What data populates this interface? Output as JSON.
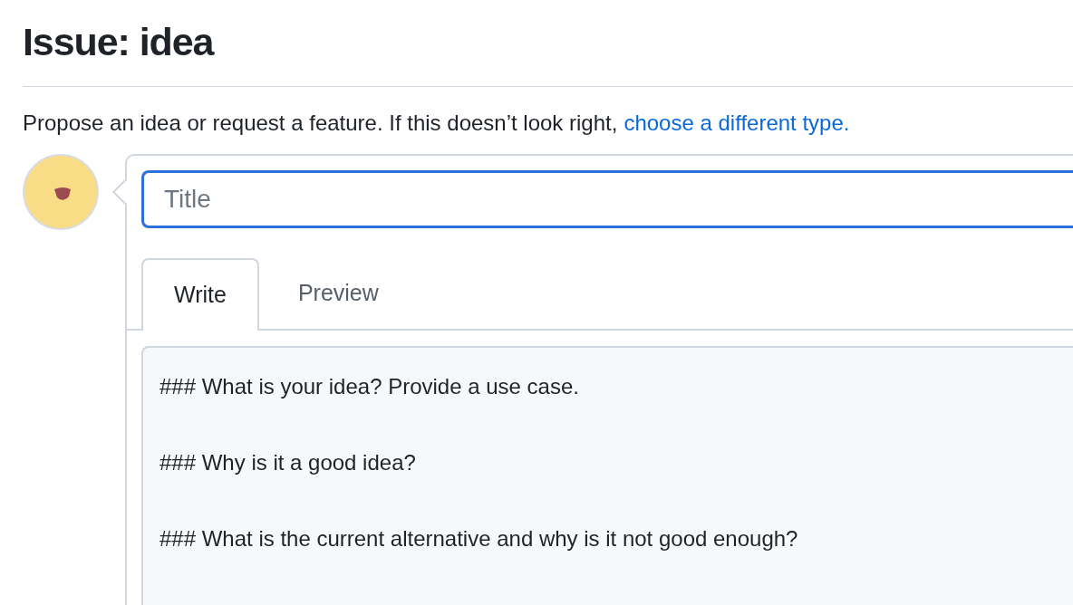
{
  "heading": "Issue: idea",
  "description": {
    "text": "Propose an idea or request a feature. If this doesn’t look right,",
    "link": "choose a different type."
  },
  "title_field": {
    "placeholder": "Title",
    "focused": true
  },
  "tabs": [
    {
      "label": "Write",
      "selected": true
    },
    {
      "label": "Preview",
      "selected": false
    }
  ],
  "body_field": {
    "value": "### What is your idea? Provide a use case.\n\n### Why is it a good idea?\n\n### What is the current alternative and why is it not good enough?"
  }
}
